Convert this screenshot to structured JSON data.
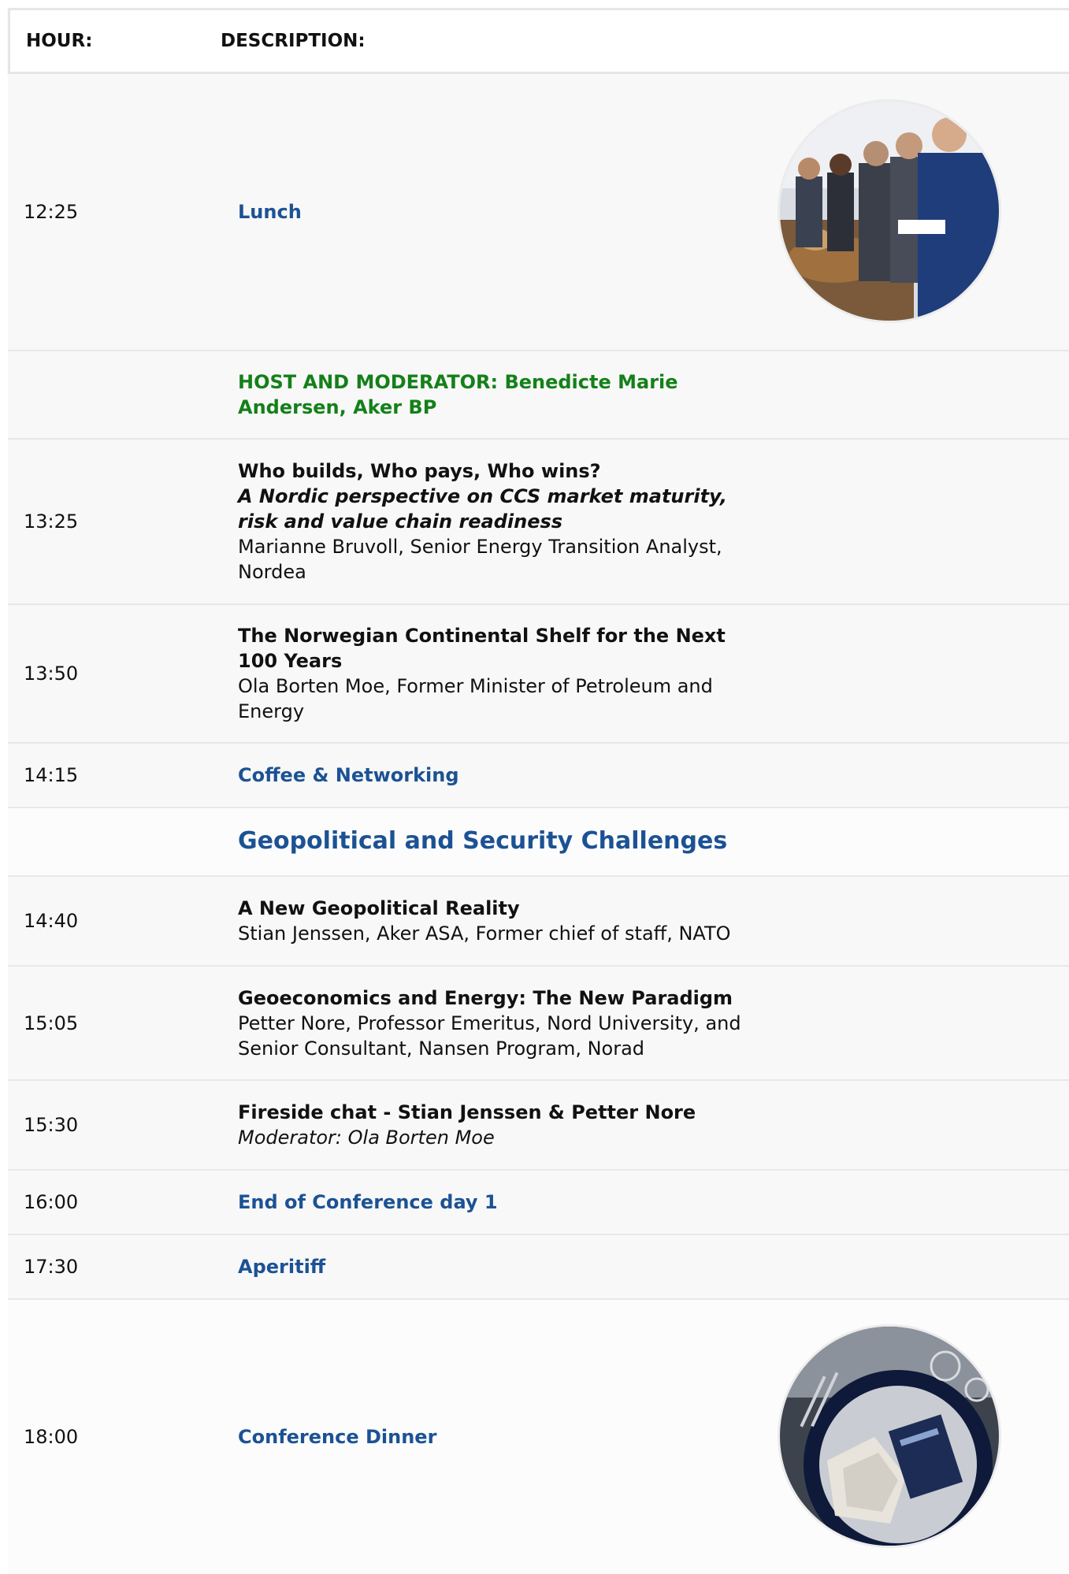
{
  "header": {
    "hour_label": "HOUR:",
    "description_label": "DESCRIPTION:"
  },
  "rows": [
    {
      "time": "12:25",
      "title": "Lunch",
      "image": "lunch-buffet-photo"
    },
    {
      "time": "",
      "title": "HOST AND MODERATOR: Benedicte Marie Andersen, Aker BP"
    },
    {
      "time": "13:25",
      "title": "Who builds, Who pays, Who wins?",
      "subtitle": "A Nordic perspective on CCS market maturity, risk and value chain readiness",
      "speaker": "Marianne Bruvoll, Senior Energy Transition Analyst, Nordea"
    },
    {
      "time": "13:50",
      "title": "The Norwegian Continental Shelf for the Next 100 Years",
      "speaker": "Ola Borten Moe, Former Minister of Petroleum and Energy"
    },
    {
      "time": "14:15",
      "title": "Coffee & Networking"
    },
    {
      "time": "",
      "title": "Geopolitical and Security Challenges"
    },
    {
      "time": "14:40",
      "title": "A New Geopolitical Reality",
      "speaker": "Stian Jenssen, Aker ASA, Former chief of staff, NATO"
    },
    {
      "time": "15:05",
      "title": "Geoeconomics and Energy: The New Paradigm",
      "speaker": "Petter Nore, Professor Emeritus, Nord University, and Senior Consultant, Nansen Program, Norad"
    },
    {
      "time": "15:30",
      "title": "Fireside chat - Stian Jenssen & Petter Nore",
      "moderator": "Moderator: Ola Borten Moe"
    },
    {
      "time": "16:00",
      "title": "End of Conference day 1"
    },
    {
      "time": "17:30",
      "title": "Aperitiff"
    },
    {
      "time": "18:00",
      "title": "Conference Dinner",
      "image": "dinner-table-photo"
    }
  ],
  "colors": {
    "link_blue": "#1c5294",
    "host_green": "#148019",
    "row_bg": "#f8f8f8",
    "divider": "#e8e8e8"
  }
}
